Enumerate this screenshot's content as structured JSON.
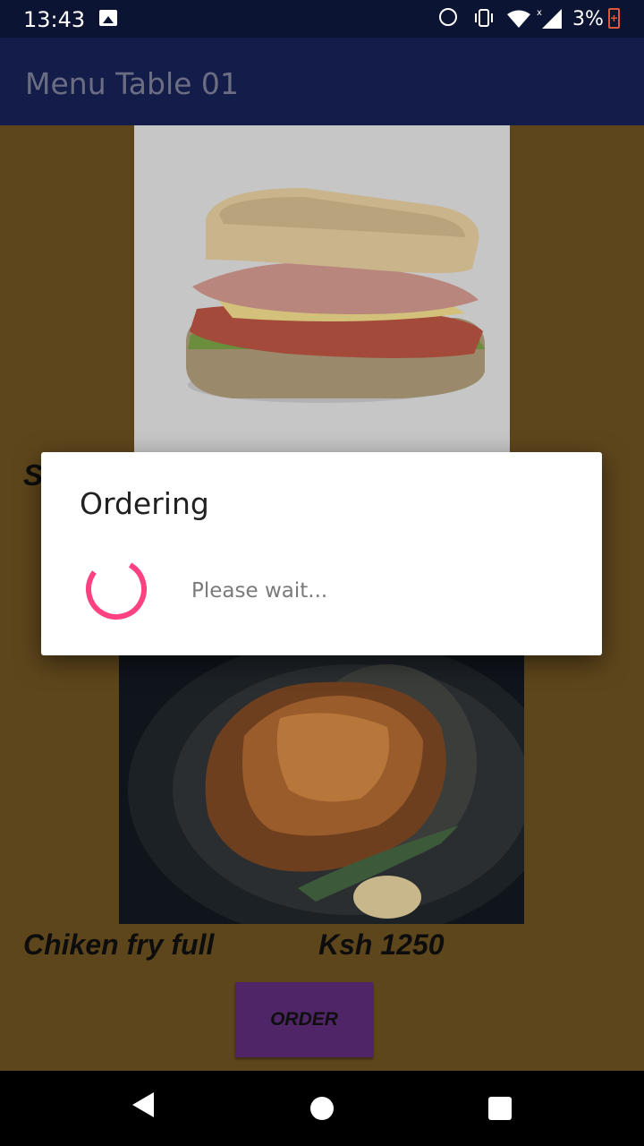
{
  "status_bar": {
    "time": "13:43",
    "battery": "3%",
    "icons": [
      "image-icon",
      "alarm-icon",
      "vibrate-icon",
      "wifi-icon",
      "signal-icon",
      "battery-icon"
    ]
  },
  "app_bar": {
    "title": "Menu Table 01"
  },
  "menu": {
    "item1": {
      "name_visible": "S",
      "image": "sandwich"
    },
    "item2": {
      "name": "Chiken fry full",
      "price": "Ksh 1250",
      "image": "roast-chicken",
      "order_label": "ORDER"
    }
  },
  "dialog": {
    "title": "Ordering",
    "message": "Please wait...",
    "spinner_color": "#ff4081"
  },
  "colors": {
    "status_bar": "#0c1433",
    "app_bar": "#141d4a",
    "content_bg": "#5e461c",
    "order_button": "#4f2567"
  },
  "nav_bar": {
    "icons": [
      "back-icon",
      "home-icon",
      "recents-icon"
    ]
  }
}
